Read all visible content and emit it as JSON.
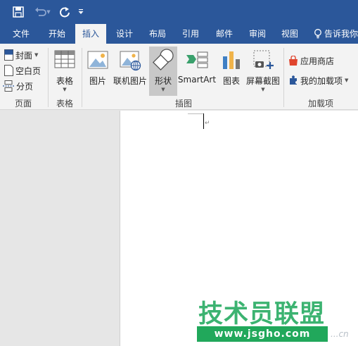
{
  "quick_access": {
    "save_icon": "save-icon",
    "undo_icon": "undo-icon",
    "redo_icon": "redo-icon",
    "customize_icon": "customize-qat-icon"
  },
  "tabs": [
    "文件",
    "开始",
    "插入",
    "设计",
    "布局",
    "引用",
    "邮件",
    "审阅",
    "视图"
  ],
  "active_tab": "插入",
  "tell_me": "告诉我你",
  "ribbon": {
    "pages_group": {
      "label": "页面",
      "cover": "封面",
      "blank_page": "空白页",
      "page_break": "分页"
    },
    "tables_group": {
      "label": "表格",
      "table": "表格"
    },
    "illustrations_group": {
      "label": "插图",
      "pictures": "图片",
      "online_pictures": "联机图片",
      "shapes": "形状",
      "smartart": "SmartArt",
      "chart": "图表",
      "screenshot": "屏幕截图"
    },
    "addins_group": {
      "label": "加载项",
      "store": "应用商店",
      "my_addins": "我的加载项"
    }
  },
  "document": {
    "paragraph_mark": "↵"
  },
  "watermark": {
    "title": "技术员联盟",
    "url": "www.jsgho.com",
    "suffix": "...cn"
  },
  "colors": {
    "title_bar": "#2b579a",
    "ribbon_bg": "#f3f3f3",
    "watermark_green": "#21a85b"
  }
}
